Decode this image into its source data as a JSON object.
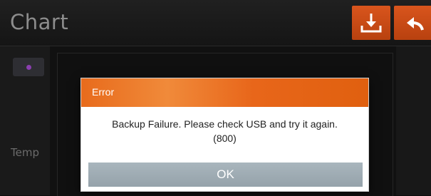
{
  "header": {
    "title": "Chart",
    "download_icon": "download-icon",
    "back_icon": "back-arrow-icon",
    "accent_color": "#d9551d"
  },
  "sidebar": {
    "axis_label": "Temp",
    "legend_color": "#8b3fb0"
  },
  "dialog": {
    "title": "Error",
    "message": "Backup Failure. Please check USB and try it again.",
    "code": "(800)",
    "ok_label": "OK",
    "header_color": "#e86b1c",
    "button_color": "#a9b6bd"
  }
}
